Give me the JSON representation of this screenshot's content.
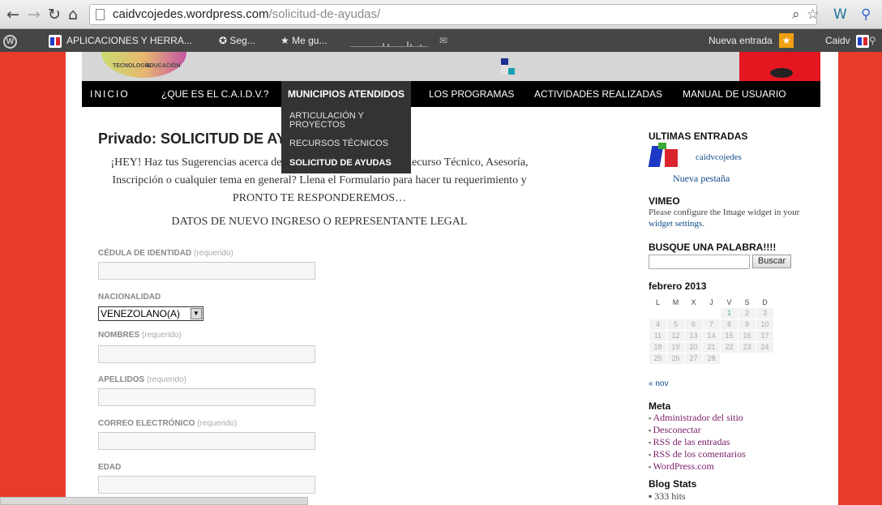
{
  "browser": {
    "url_domain": "caidvcojedes.wordpress.com",
    "url_path": "/solicitud-de-ayudas/"
  },
  "adminbar": {
    "site_name": "APLICACIONES Y HERRA...",
    "seg": "Seg...",
    "megu": "Me gu...",
    "new_entry": "Nueva entrada",
    "user": "Caidv"
  },
  "nav": {
    "items": [
      "INICIO",
      "¿QUE ES EL C.A.I.D.V.?",
      "MUNICIPIOS ATENDIDOS",
      "LOS PROGRAMAS",
      "ACTIVIDADES REALIZADAS",
      "MANUAL DE USUARIO"
    ],
    "dropdown": [
      "ARTICULACIÓN Y PROYECTOS",
      "RECURSOS TÉCNICOS",
      "SOLICITUD DE AYUDAS"
    ]
  },
  "header": {
    "logo_left": "TECNOLOGÍA",
    "logo_right": "EDUCACIÓN"
  },
  "post": {
    "title": "Privado: SOLICITUD DE AYUDAS",
    "intro": "¡HEY! Haz tus Sugerencias acerca de Ayudas, ¿Requieres de un Recurso Técnico, Asesoría, Inscripción o cualquier tema en general? Llena el Formulario para hacer tu requerimiento y PRONTO TE RESPONDEREMOS…",
    "section": "DATOS DE NUEVO INGRESO O REPRESENTANTE LEGAL"
  },
  "form": {
    "required_text": "(requerido)",
    "cedula": "CÉDULA DE IDENTIDAD",
    "nacionalidad": "NACIONALIDAD",
    "nacionalidad_value": "VENEZOLANO(A)",
    "nombres": "NOMBRES",
    "apellidos": "APELLIDOS",
    "correo": "CORREO ELECTRÓNICO",
    "edad": "EDAD"
  },
  "sidebar": {
    "ultimas": "ULTIMAS ENTRADAS",
    "entry_user": "caidvcojedes",
    "entry_title": "Nueva pestaña",
    "vimeo": "VIMEO",
    "vimeo_text": "Please configure the Image widget in your",
    "vimeo_link": "widget settings",
    "busque": "BUSQUE UNA PALABRA!!!!",
    "buscar": "Buscar",
    "month": "febrero 2013",
    "weekdays": [
      "L",
      "M",
      "X",
      "J",
      "V",
      "S",
      "D"
    ],
    "prev": "« nov",
    "meta": "Meta",
    "meta_links": [
      "Administrador del sitio",
      "Desconectar",
      "RSS de las entradas",
      "RSS de los comentarios",
      "WordPress.com"
    ],
    "stats": "Blog Stats",
    "hits": "333 hits"
  }
}
